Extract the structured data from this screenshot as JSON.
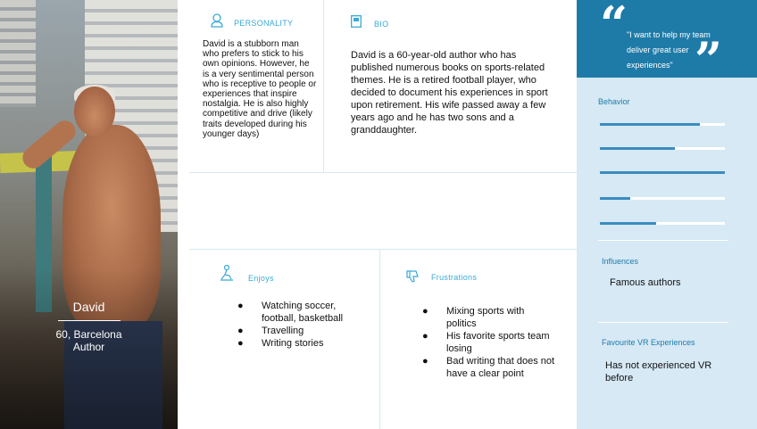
{
  "persona": {
    "name": "David",
    "location": "60, Barcelona",
    "occupation": "Author"
  },
  "personality": {
    "title": "PERSONALITY",
    "text": "David is a stubborn man who prefers to stick to his own opinions. However, he is a very sentimental person who is receptive to people or experiences that inspire nostalgia. He is also highly competitive and drive (likely traits developed during his younger days)"
  },
  "bio": {
    "title": "BIO",
    "text": "David is a 60-year-old author who has published numerous books on sports-related themes. He is a retired football player, who decided to document his experiences in sport upon retirement. His wife passed away a few years ago and he has two sons and a granddaughter."
  },
  "enjoys": {
    "title": "Enjoys",
    "items": [
      "Watching soccer, football, basketball",
      "Travelling",
      "Writing stories"
    ]
  },
  "frustrations": {
    "title": "Frustrations",
    "items": [
      "Mixing sports with politics",
      "His favorite sports team losing",
      "Bad writing that does not have a clear point"
    ]
  },
  "quote": "\"I want to help my team deliver great user experiences\"",
  "behavior": {
    "title": "Behavior",
    "levels": [
      0.8,
      0.6,
      1.0,
      0.24,
      0.45
    ]
  },
  "influences": {
    "title": "Influences",
    "text": "Famous authors"
  },
  "vr": {
    "title": "Favourite VR Experiences",
    "text": "Has not experienced VR before"
  },
  "colors": {
    "accent": "#1e7ba8",
    "panel": "#d7e9f5",
    "bar": "#3a8cc0"
  }
}
